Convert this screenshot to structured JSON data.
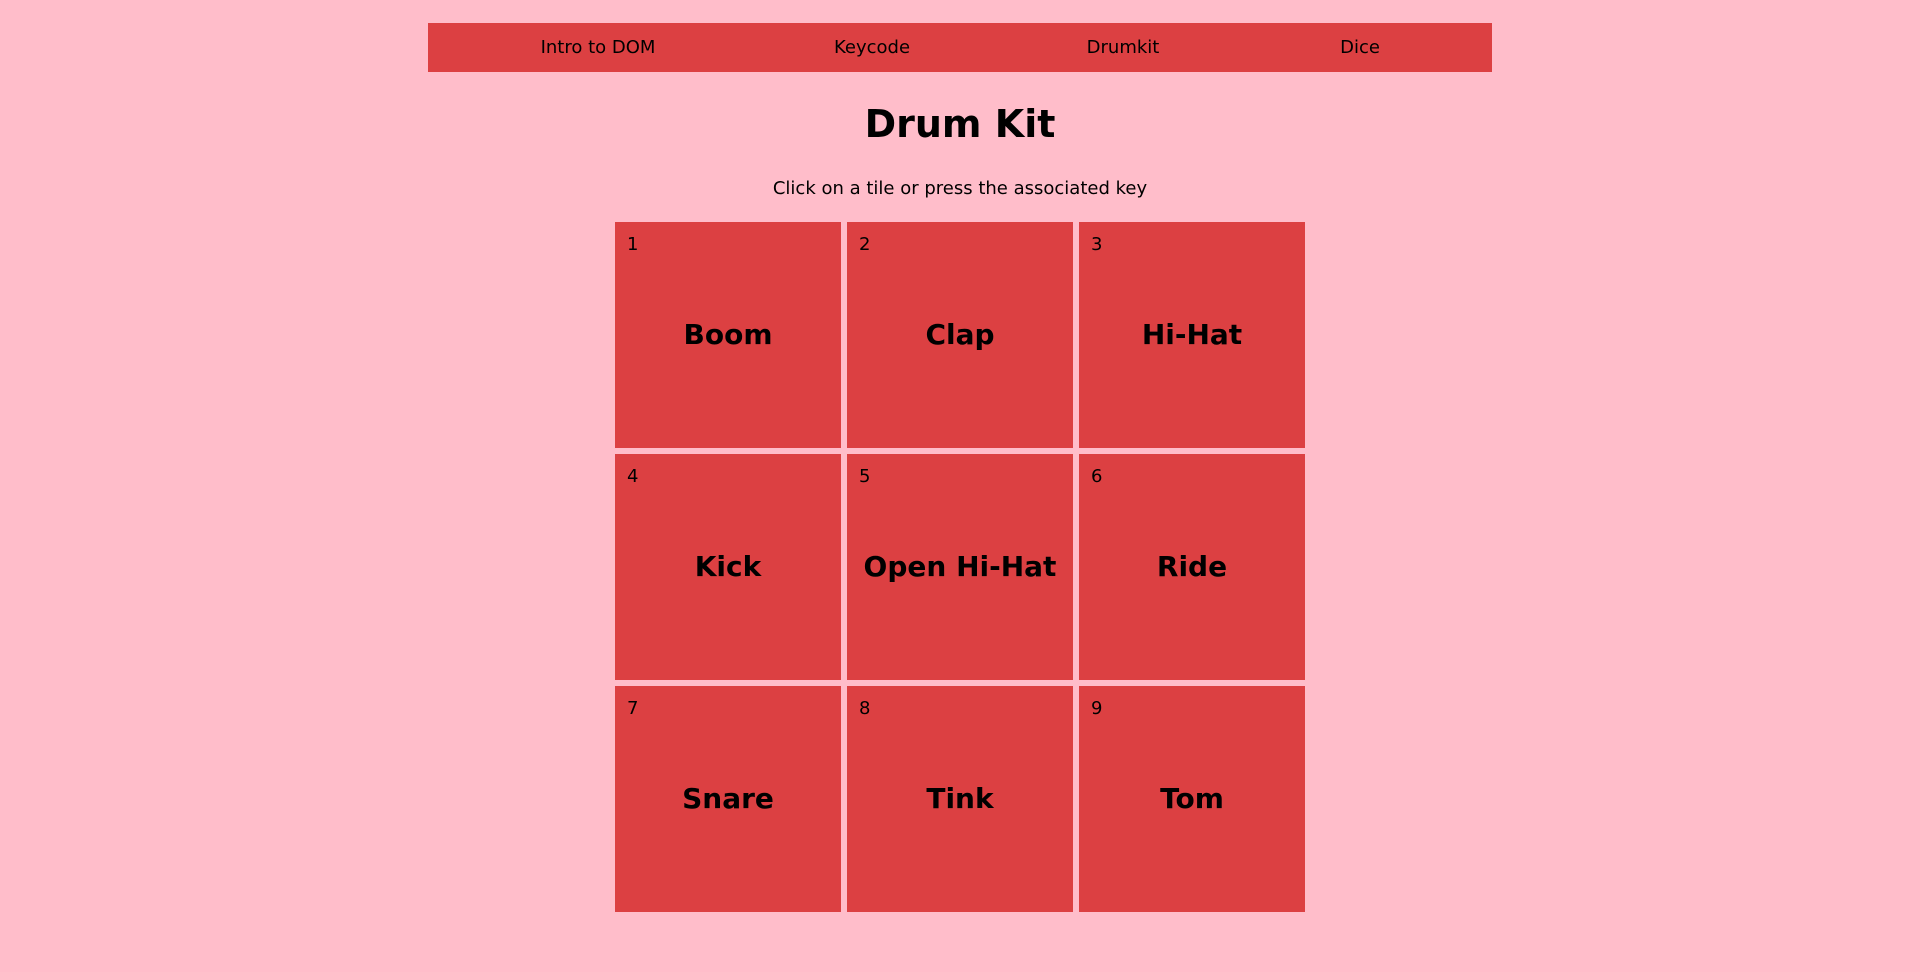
{
  "nav": {
    "links": [
      {
        "label": "Intro to DOM"
      },
      {
        "label": "Keycode"
      },
      {
        "label": "Drumkit"
      },
      {
        "label": "Dice"
      }
    ]
  },
  "page": {
    "title": "Drum Kit",
    "subtitle": "Click on a tile or press the associated key"
  },
  "tiles": [
    {
      "key": "1",
      "name": "Boom"
    },
    {
      "key": "2",
      "name": "Clap"
    },
    {
      "key": "3",
      "name": "Hi-Hat"
    },
    {
      "key": "4",
      "name": "Kick"
    },
    {
      "key": "5",
      "name": "Open Hi-Hat"
    },
    {
      "key": "6",
      "name": "Ride"
    },
    {
      "key": "7",
      "name": "Snare"
    },
    {
      "key": "8",
      "name": "Tink"
    },
    {
      "key": "9",
      "name": "Tom"
    }
  ],
  "colors": {
    "background": "#ffbdca",
    "accent": "#dc4042"
  }
}
